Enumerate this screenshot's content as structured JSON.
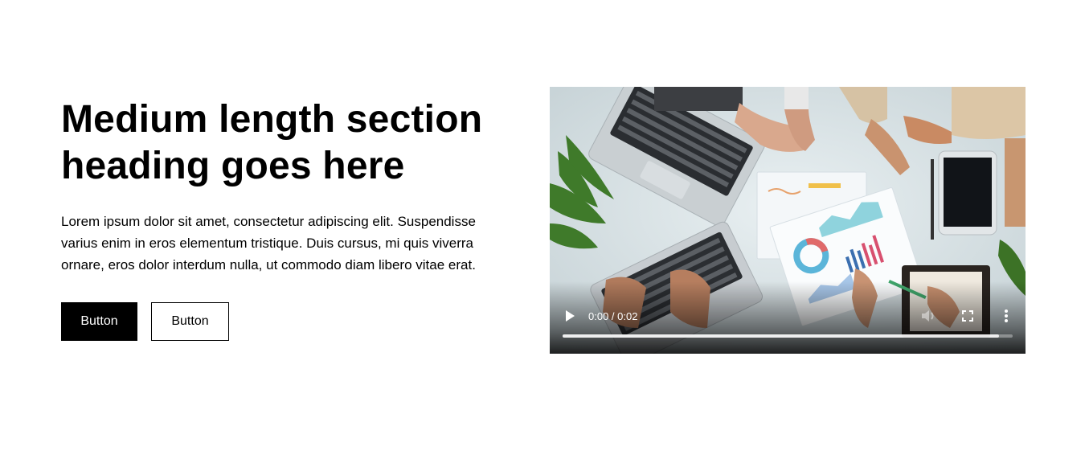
{
  "section": {
    "heading": "Medium length section heading goes here",
    "body": "Lorem ipsum dolor sit amet, consectetur adipiscing elit. Suspendisse varius enim in eros elementum tristique. Duis cursus, mi quis viverra ornare, eros dolor interdum nulla, ut commodo diam libero vitae erat."
  },
  "actions": {
    "primary_label": "Button",
    "secondary_label": "Button"
  },
  "video": {
    "time_display": "0:00 / 0:02",
    "progress": 0.97,
    "muted_state": "volume-disabled",
    "icons": [
      "play-icon",
      "volume-icon",
      "fullscreen-icon",
      "more-vert-icon"
    ]
  },
  "colors": {
    "text": "#000000",
    "background": "#ffffff",
    "primary_button_bg": "#000000",
    "primary_button_text": "#ffffff",
    "secondary_button_border": "#000000"
  }
}
